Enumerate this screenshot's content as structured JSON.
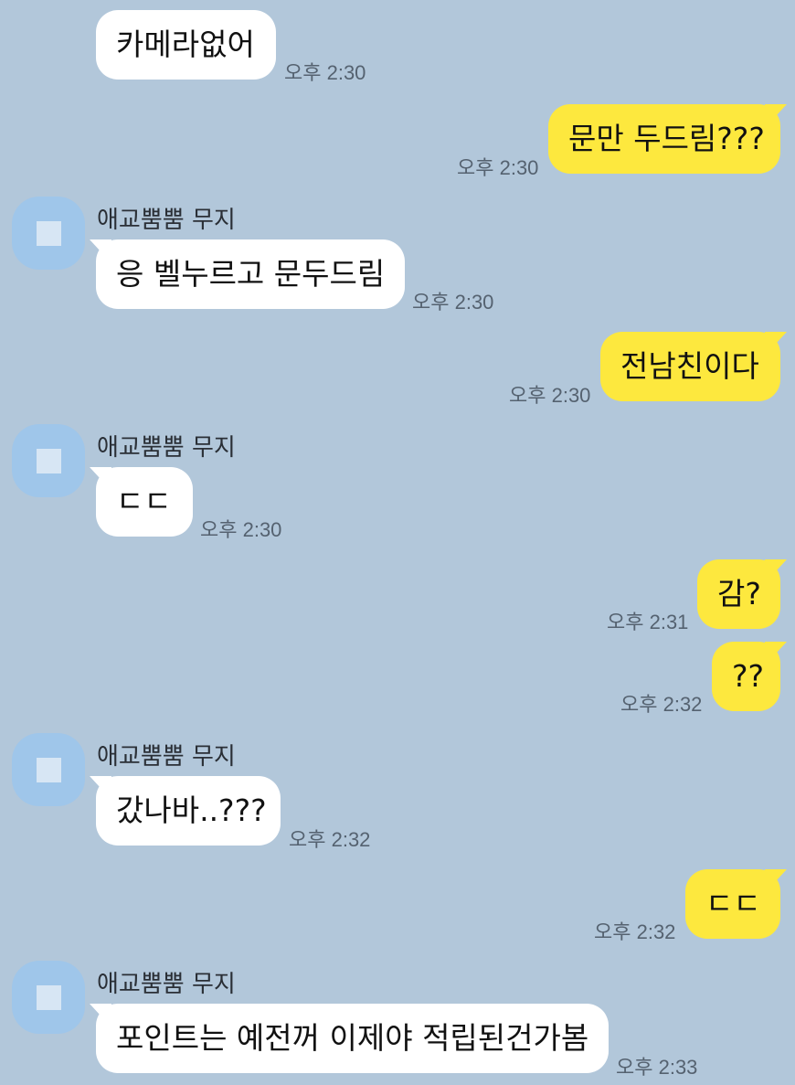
{
  "contact": {
    "name": "애교뿜뿜 무지"
  },
  "messages": [
    {
      "side": "in",
      "text": "카메라없어",
      "time": "오후 2:30"
    },
    {
      "side": "out",
      "text": "문만 두드림???",
      "time": "오후 2:30"
    },
    {
      "side": "in",
      "text": "응 벨누르고 문두드림",
      "time": "오후 2:30"
    },
    {
      "side": "out",
      "text": "전남친이다",
      "time": "오후 2:30"
    },
    {
      "side": "in",
      "text": "ㄷㄷ",
      "time": "오후 2:30"
    },
    {
      "side": "out",
      "text": "감?",
      "time": "오후 2:31"
    },
    {
      "side": "out",
      "text": "??",
      "time": "오후 2:32"
    },
    {
      "side": "in",
      "text": "갔나바..???",
      "time": "오후 2:32"
    },
    {
      "side": "out",
      "text": "ㄷㄷ",
      "time": "오후 2:32"
    },
    {
      "side": "in",
      "text": "포인트는 예전꺼 이제야 적립된건가봄",
      "time": "오후 2:33"
    }
  ],
  "colors": {
    "background": "#b2c7da",
    "incoming_bubble": "#ffffff",
    "outgoing_bubble": "#fde83e",
    "avatar": "#9fc6ea"
  }
}
